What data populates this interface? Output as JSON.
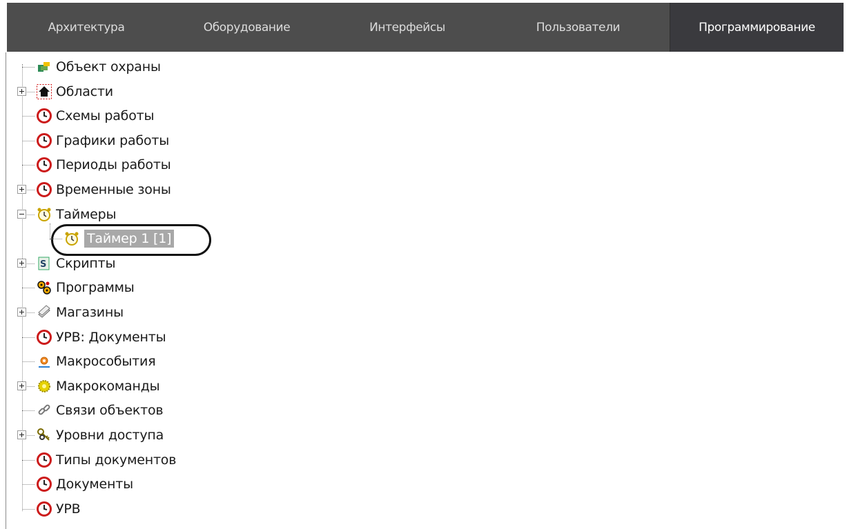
{
  "tabs": [
    {
      "label": "Архитектура",
      "active": false
    },
    {
      "label": "Оборудование",
      "active": false
    },
    {
      "label": "Интерфейсы",
      "active": false
    },
    {
      "label": "Пользователи",
      "active": false
    },
    {
      "label": "Программирование",
      "active": true
    }
  ],
  "tree": {
    "items": [
      {
        "label": "Объект охраны",
        "icon": "security-object-icon",
        "expander": "none"
      },
      {
        "label": "Области",
        "icon": "home-icon",
        "expander": "plus"
      },
      {
        "label": "Схемы работы",
        "icon": "clock-icon",
        "expander": "none"
      },
      {
        "label": "Графики работы",
        "icon": "clock-icon",
        "expander": "none"
      },
      {
        "label": "Периоды работы",
        "icon": "clock-icon",
        "expander": "none"
      },
      {
        "label": "Временные зоны",
        "icon": "clock-icon",
        "expander": "plus"
      },
      {
        "label": "Таймеры",
        "icon": "alarm-clock-icon",
        "expander": "minus"
      },
      {
        "label": "Таймер 1 [1]",
        "icon": "alarm-clock-icon",
        "expander": "none",
        "child": true,
        "selected": true
      },
      {
        "label": "Скрипты",
        "icon": "script-icon",
        "expander": "plus"
      },
      {
        "label": "Программы",
        "icon": "gears-icon",
        "expander": "none"
      },
      {
        "label": "Магазины",
        "icon": "stack-icon",
        "expander": "plus"
      },
      {
        "label": "УРВ: Документы",
        "icon": "clock-icon",
        "expander": "none"
      },
      {
        "label": "Макрособытия",
        "icon": "macro-event-icon",
        "expander": "none"
      },
      {
        "label": "Макрокоманды",
        "icon": "macro-command-icon",
        "expander": "plus"
      },
      {
        "label": "Связи объектов",
        "icon": "link-icon",
        "expander": "none"
      },
      {
        "label": "Уровни доступа",
        "icon": "keys-icon",
        "expander": "plus"
      },
      {
        "label": "Типы документов",
        "icon": "clock-icon",
        "expander": "none"
      },
      {
        "label": "Документы",
        "icon": "clock-icon",
        "expander": "none"
      },
      {
        "label": "УРВ",
        "icon": "clock-icon",
        "expander": "none"
      }
    ]
  },
  "colors": {
    "tab_bg": "#4d4d4d",
    "tab_active_bg": "#3a3a3e",
    "clock_red": "#cc1a1a",
    "selection_bg": "#a8a8a8"
  }
}
